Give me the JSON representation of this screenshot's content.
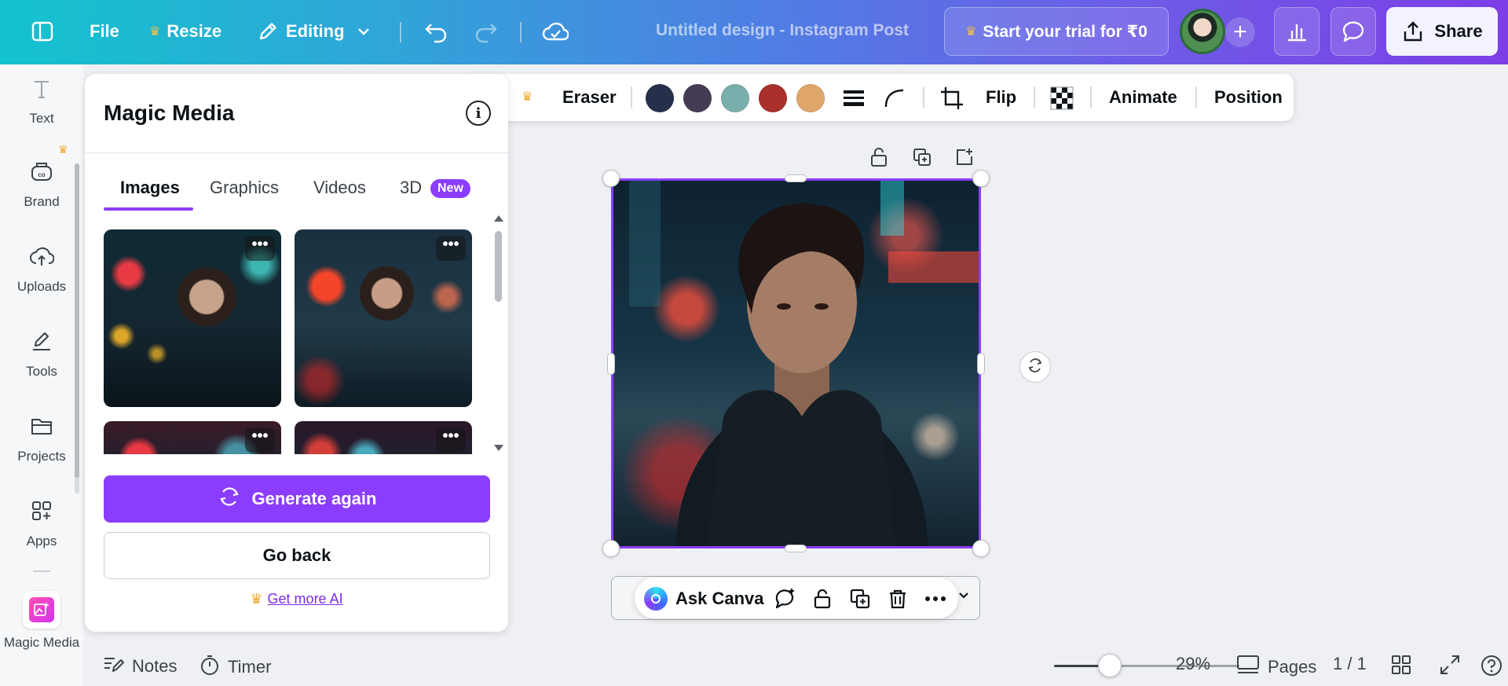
{
  "topbar": {
    "file_label": "File",
    "resize_label": "Resize",
    "editing_label": "Editing",
    "doc_title": "Untitled design - Instagram Post",
    "trial_label": "Start your trial for ₹0",
    "share_label": "Share"
  },
  "rail": {
    "items": [
      {
        "label": "Text"
      },
      {
        "label": "Brand"
      },
      {
        "label": "Uploads"
      },
      {
        "label": "Tools"
      },
      {
        "label": "Projects"
      },
      {
        "label": "Apps"
      },
      {
        "label": "Magic Media"
      }
    ]
  },
  "panel": {
    "title": "Magic Media",
    "tabs": [
      {
        "label": "Images"
      },
      {
        "label": "Graphics"
      },
      {
        "label": "Videos"
      },
      {
        "label": "3D"
      }
    ],
    "active_tab": "Images",
    "new_badge": "New",
    "thumb_menu": "•••",
    "generate_label": "Generate again",
    "back_label": "Go back",
    "more_ai_label": "Get more AI"
  },
  "context_toolbar": {
    "eraser_label": "Eraser",
    "flip_label": "Flip",
    "animate_label": "Animate",
    "position_label": "Position",
    "swatches": [
      "#26304a",
      "#463b55",
      "#7aaeac",
      "#a9302b",
      "#dfa76a"
    ]
  },
  "floating_bar": {
    "ask_label": "Ask Canva"
  },
  "bottombar": {
    "notes_label": "Notes",
    "timer_label": "Timer",
    "zoom_value": "29%",
    "zoom_level": 0.29,
    "pages_label": "Pages",
    "page_count": "1 / 1"
  },
  "colors": {
    "accent": "#8b3dff",
    "crown": "#f0a52b"
  }
}
